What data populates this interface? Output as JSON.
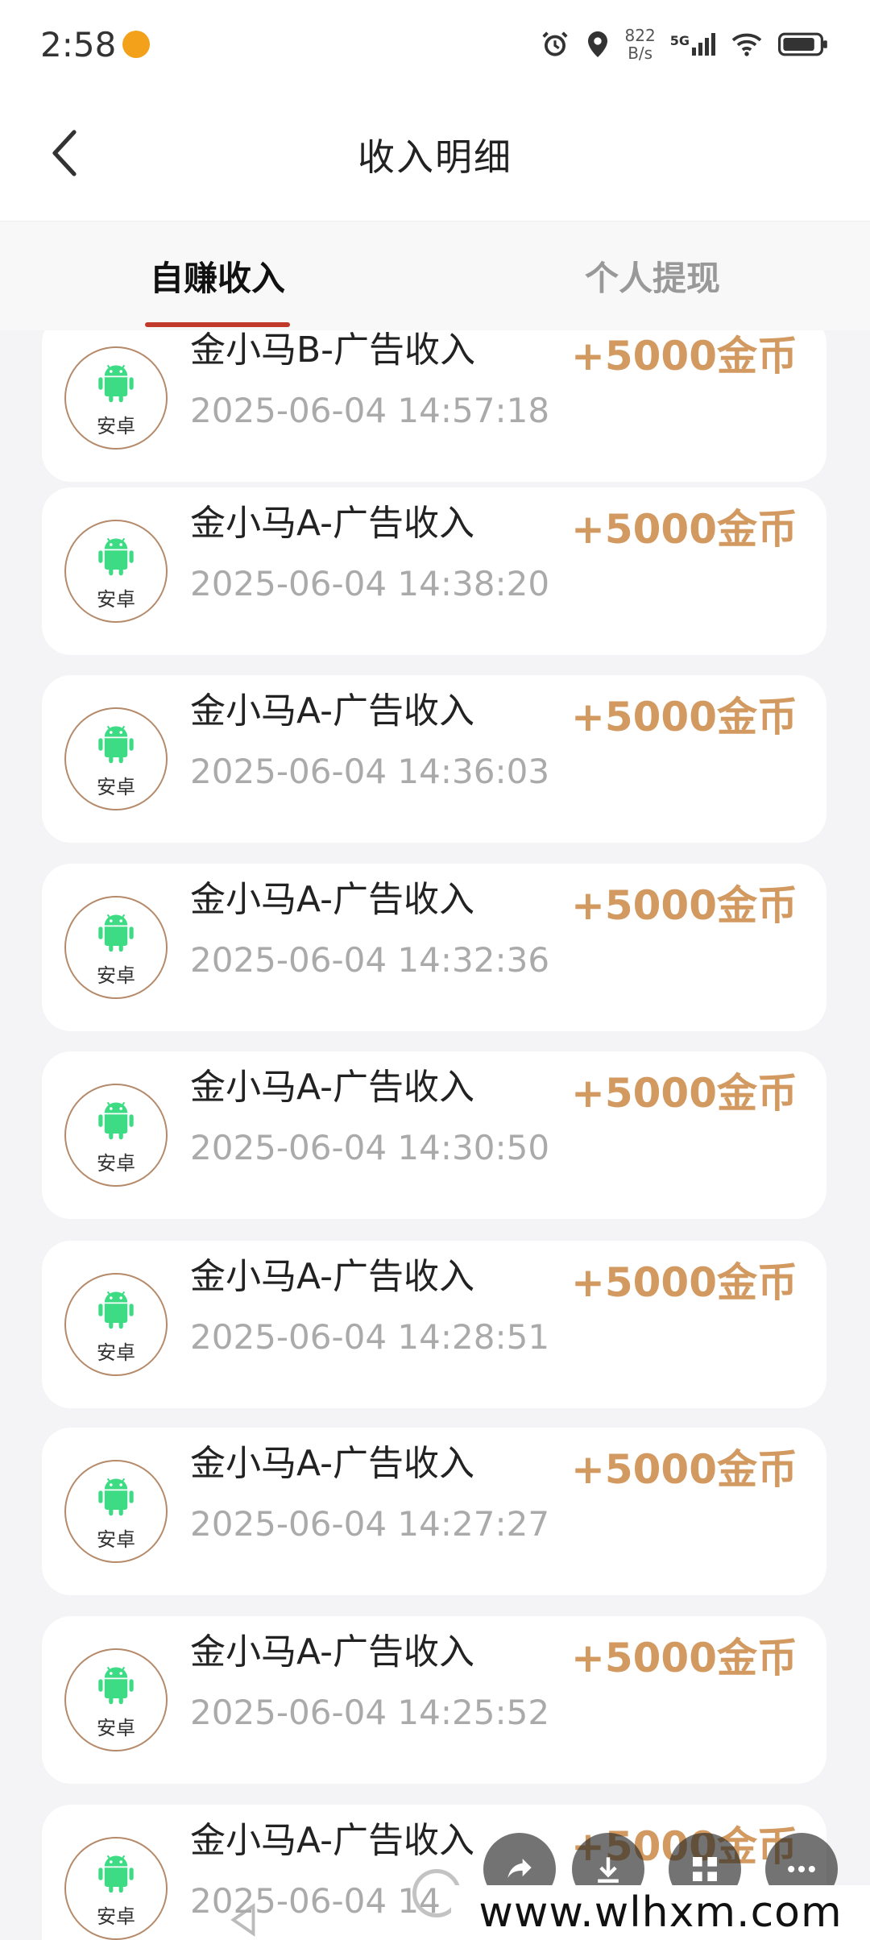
{
  "status_bar": {
    "time": "2:58",
    "speed_value": "822",
    "speed_unit": "B/s",
    "network": "5G"
  },
  "header": {
    "title": "收入明细"
  },
  "tabs": [
    {
      "label": "自赚收入",
      "active": true
    },
    {
      "label": "个人提现",
      "active": false
    }
  ],
  "records": [
    {
      "badge": "安卓",
      "title": "金小马B-广告收入",
      "time": "2025-06-04 14:57:18",
      "amount": "+5000金币"
    },
    {
      "badge": "安卓",
      "title": "金小马A-广告收入",
      "time": "2025-06-04 14:38:20",
      "amount": "+5000金币"
    },
    {
      "badge": "安卓",
      "title": "金小马A-广告收入",
      "time": "2025-06-04 14:36:03",
      "amount": "+5000金币"
    },
    {
      "badge": "安卓",
      "title": "金小马A-广告收入",
      "time": "2025-06-04 14:32:36",
      "amount": "+5000金币"
    },
    {
      "badge": "安卓",
      "title": "金小马A-广告收入",
      "time": "2025-06-04 14:30:50",
      "amount": "+5000金币"
    },
    {
      "badge": "安卓",
      "title": "金小马A-广告收入",
      "time": "2025-06-04 14:28:51",
      "amount": "+5000金币"
    },
    {
      "badge": "安卓",
      "title": "金小马A-广告收入",
      "time": "2025-06-04 14:27:27",
      "amount": "+5000金币"
    },
    {
      "badge": "安卓",
      "title": "金小马A-广告收入",
      "time": "2025-06-04 14:25:52",
      "amount": "+5000金币"
    },
    {
      "badge": "安卓",
      "title": "金小马A-广告收入",
      "time": "2025-06-04 14",
      "amount": "+5000金币"
    }
  ],
  "watermark": "www.wlhxm.com",
  "colors": {
    "accent": "#c0392b",
    "amount": "#d29a60",
    "android_green": "#3ddc84"
  }
}
